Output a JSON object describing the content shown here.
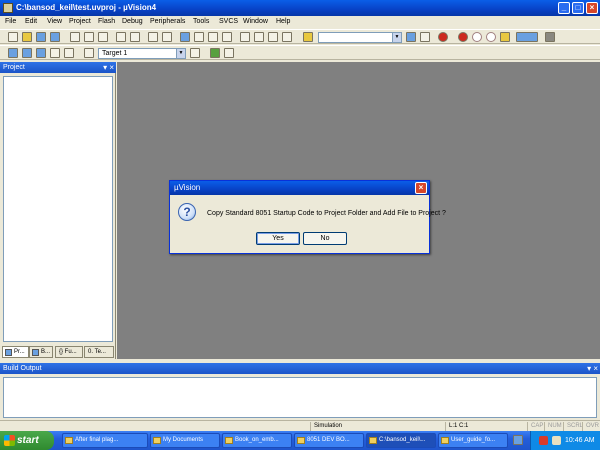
{
  "window": {
    "title": "C:\\bansod_keil\\test.uvproj - µVision4",
    "minimize_glyph": "_",
    "maximize_glyph": "□",
    "close_glyph": "×"
  },
  "menu": [
    "File",
    "Edit",
    "View",
    "Project",
    "Flash",
    "Debug",
    "Peripherals",
    "Tools",
    "SVCS",
    "Window",
    "Help"
  ],
  "toolbar": {
    "find_combo_value": "",
    "target_combo_value": "Target 1",
    "combo_arrow": "▼"
  },
  "project_panel": {
    "title": "Project",
    "header_buttons": "▾ ×",
    "tabs": [
      "Pr...",
      "B...",
      "{} Fu...",
      "0. Te..."
    ]
  },
  "build_output": {
    "title": "Build Output",
    "header_buttons": "▾ ×"
  },
  "statusbar": {
    "mode": "Simulation",
    "position": "L:1 C:1",
    "indicators": [
      "CAP",
      "NUM",
      "SCRL",
      "OVR"
    ]
  },
  "dialog": {
    "title": "µVision",
    "close_glyph": "×",
    "icon_glyph": "?",
    "message": "Copy Standard 8051 Startup Code to Project Folder and Add File to Project ?",
    "yes_label": "Yes",
    "no_label": "No"
  },
  "taskbar": {
    "start_label": "start",
    "buttons": [
      "After final plag...",
      "My Documents",
      "Book_on_emb...",
      "8051 DEV BO...",
      "C:\\bansod_keil\\...",
      "User_guide_fo..."
    ],
    "clock": "10:46 AM"
  },
  "colors": {
    "title_blue": "#0842c6",
    "editor_gray": "#808080",
    "taskbar_blue": "#245edb",
    "start_green": "#2f8a2f"
  }
}
